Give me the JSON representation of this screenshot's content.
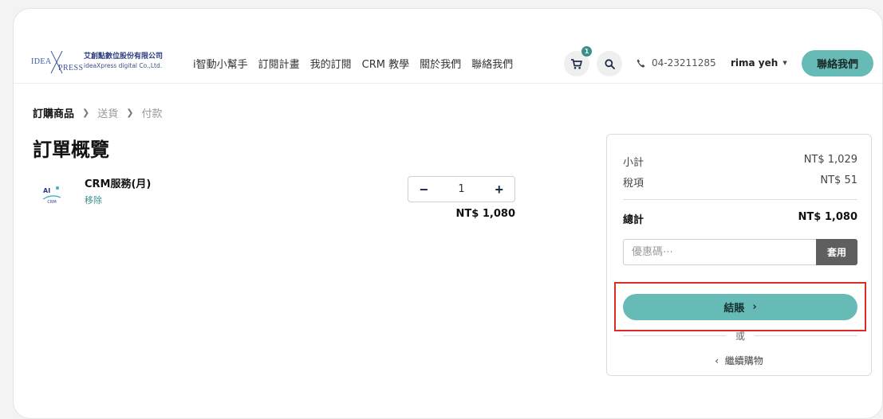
{
  "header": {
    "logo": {
      "mark_left": "IDEA",
      "mark_right": "PRESS",
      "company_cn": "艾創點數位股份有限公司",
      "company_en": "ideaXpress digital Co.,Ltd."
    },
    "nav": [
      "i智動小幫手",
      "訂閱計畫",
      "我的訂閱",
      "CRM 教學",
      "關於我們",
      "聯絡我們"
    ],
    "cart_count": "1",
    "phone": "04-23211285",
    "user_name": "rima yeh",
    "contact_label": "聯絡我們"
  },
  "breadcrumb": {
    "steps": [
      "訂購商品",
      "送貨",
      "付款"
    ]
  },
  "page_title": "訂單概覽",
  "product": {
    "thumb_top": "AI",
    "thumb_bottom": "CRM",
    "name": "CRM服務(月)",
    "remove_label": "移除",
    "quantity": "1",
    "line_price": "NT$ 1,080"
  },
  "summary": {
    "subtotal_label": "小計",
    "subtotal_value": "NT$ 1,029",
    "tax_label": "稅項",
    "tax_value": "NT$ 51",
    "total_label": "總計",
    "total_value": "NT$ 1,080",
    "coupon_placeholder": "優惠碼⋯",
    "coupon_apply": "套用",
    "checkout_label": "結賬",
    "or_label": "或",
    "continue_label": "繼續購物"
  },
  "colors": {
    "accent": "#67bbb7",
    "highlight_frame": "#e02a2a",
    "badge": "#3a8f8a"
  }
}
